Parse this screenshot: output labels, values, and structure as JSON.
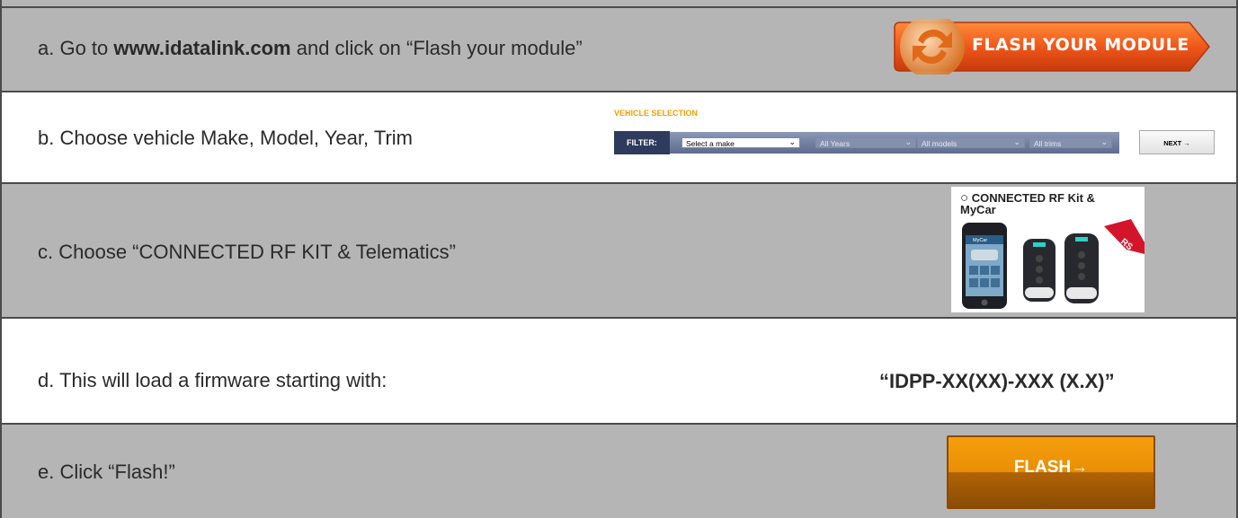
{
  "steps": [
    {
      "prefix": "a. Go to ",
      "bold": "www.idatalink.com",
      "suffix": " and click on “Flash your module”"
    },
    {
      "text": "b. Choose vehicle Make, Model, Year, Trim"
    },
    {
      "text": "c. Choose “CONNECTED RF KIT & Telematics”"
    },
    {
      "text": "d. This will load a firmware starting with:"
    },
    {
      "text": "e. Click “Flash!”"
    }
  ],
  "flash_module_button": {
    "label": "FLASH YOUR MODULE"
  },
  "vehicle_selection": {
    "title": "VEHICLE SELECTION",
    "filter_label": "FILTER:",
    "make": "Select a make",
    "years": "All Years",
    "models": "All models",
    "trims": "All trims",
    "next": "NEXT →"
  },
  "kit_card": {
    "radio": "○",
    "title": "CONNECTED RF Kit & MyCar",
    "ribbon": "RS",
    "phone_brand": "MyCar"
  },
  "firmware": "“IDPP-XX(XX)-XXX (X.X)”",
  "flash_button": {
    "label": "FLASH→"
  },
  "colors": {
    "row_gray": "#b5b5b5",
    "border": "#4a4a4a",
    "accent_orange": "#e88e04",
    "filter_navy": "#2f3b5c"
  }
}
